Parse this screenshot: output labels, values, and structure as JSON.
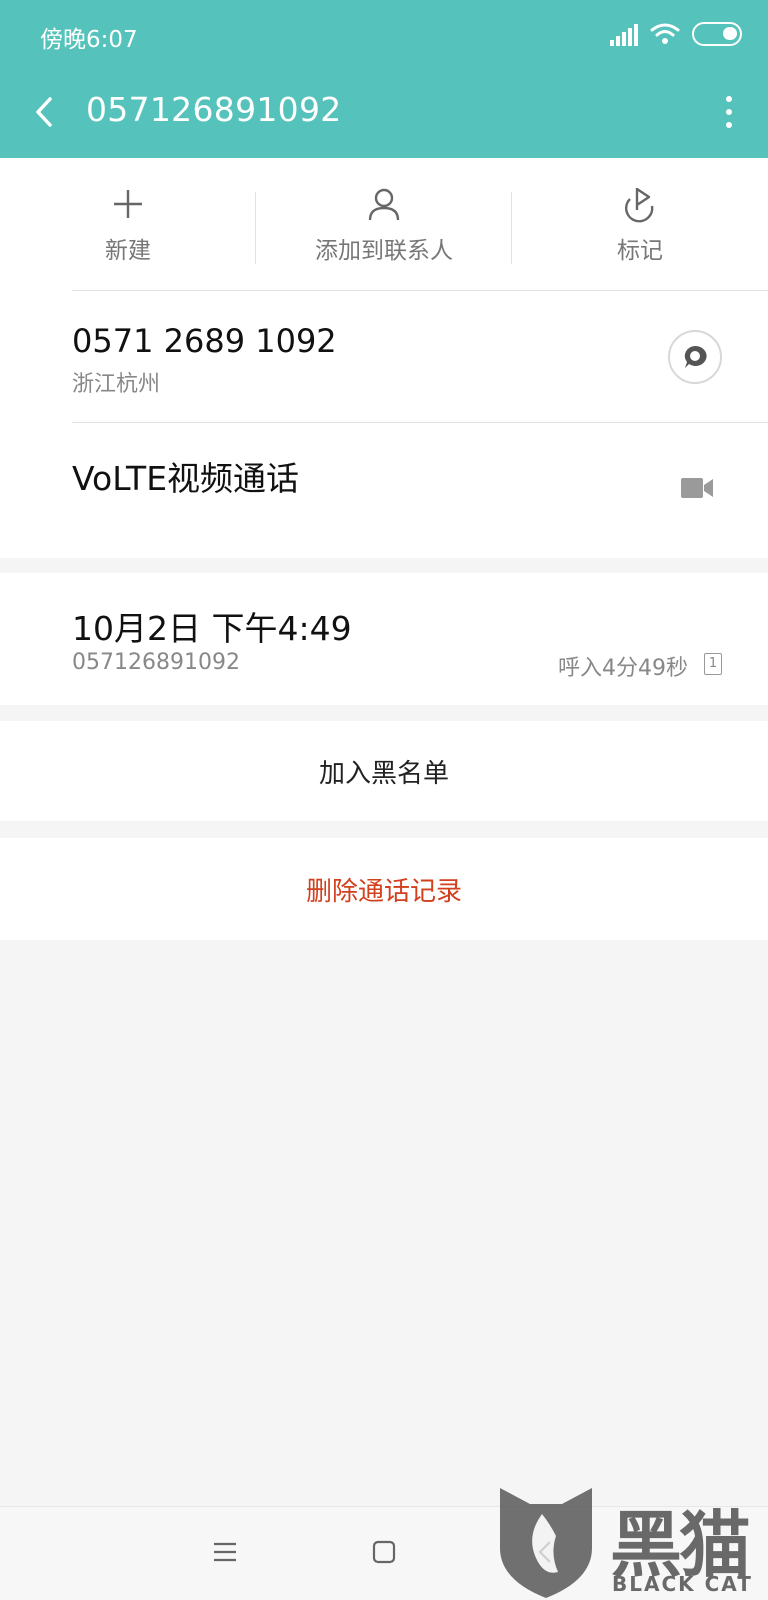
{
  "status_bar": {
    "time": "傍晚6:07",
    "icons": [
      "signal-icon",
      "wifi-icon",
      "battery-icon"
    ]
  },
  "header": {
    "title": "057126891092",
    "background": "#55c3bb",
    "icons": [
      "back-arrow-icon",
      "more-vertical-icon"
    ]
  },
  "actions": [
    {
      "label": "新建",
      "icon": "plus-icon"
    },
    {
      "label": "添加到联系人",
      "icon": "person-icon"
    },
    {
      "label": "标记",
      "icon": "flag-icon"
    }
  ],
  "number_info": {
    "number": "0571 2689 1092",
    "location": "浙江杭州",
    "icon": "message-icon"
  },
  "video_call": {
    "label": "VoLTE视频通话",
    "icon": "video-camera-icon"
  },
  "call_log": {
    "date": "10月2日 下午4:49",
    "number": "057126891092",
    "type_duration": "呼入4分49秒",
    "sim": "1"
  },
  "buttons": {
    "blacklist": "加入黑名单",
    "delete": "删除通话记录",
    "delete_color": "#d2401e"
  },
  "nav_bar": {
    "icons": [
      "menu-icon",
      "home-icon",
      "back-icon"
    ]
  },
  "watermark": {
    "text": "黑猫",
    "sub": "BLACK CAT",
    "icon": "black-cat-logo-icon"
  }
}
